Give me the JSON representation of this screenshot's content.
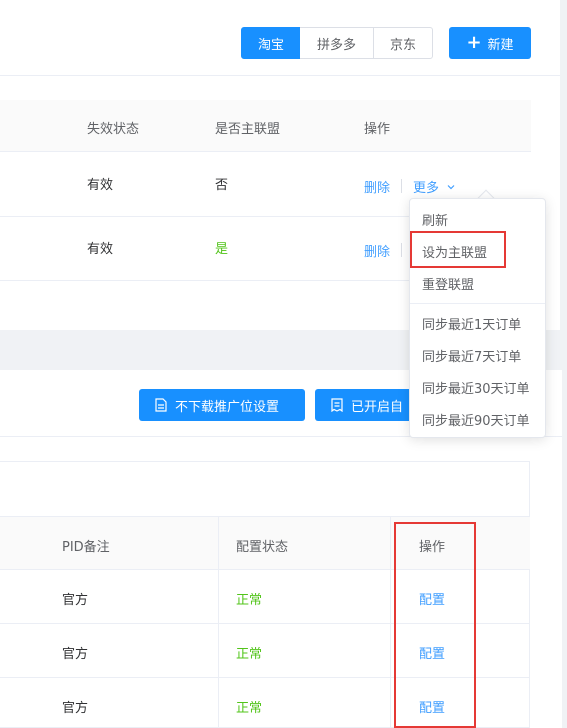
{
  "platform_tabs": [
    "淘宝",
    "拼多多",
    "京东"
  ],
  "new_button_label": "新建",
  "union_table": {
    "headers": {
      "status": "失效状态",
      "is_main": "是否主联盟",
      "actions": "操作"
    },
    "rows": [
      {
        "status": "有效",
        "is_main": "否",
        "delete_label": "删除",
        "more_label": "更多"
      },
      {
        "status": "有效",
        "is_main": "是",
        "delete_label": "删除"
      }
    ]
  },
  "more_menu": {
    "items": [
      "刷新",
      "设为主联盟",
      "重登联盟"
    ],
    "sync_items": [
      "同步最近1天订单",
      "同步最近7天订单",
      "同步最近30天订单",
      "同步最近90天订单"
    ]
  },
  "toolbar": {
    "no_download_label": "不下载推广位设置",
    "enabled_label": "已开启自"
  },
  "pid_table": {
    "headers": {
      "remark": "PID备注",
      "config_status": "配置状态",
      "actions": "操作"
    },
    "rows": [
      {
        "remark": "官方",
        "config_status": "正常",
        "action": "配置"
      },
      {
        "remark": "官方",
        "config_status": "正常",
        "action": "配置"
      },
      {
        "remark": "官方",
        "config_status": "正常",
        "action": "配置"
      }
    ]
  },
  "colors": {
    "primary": "#1890ff",
    "link": "#409eff",
    "success": "#52c41a",
    "highlight": "#e53935"
  }
}
